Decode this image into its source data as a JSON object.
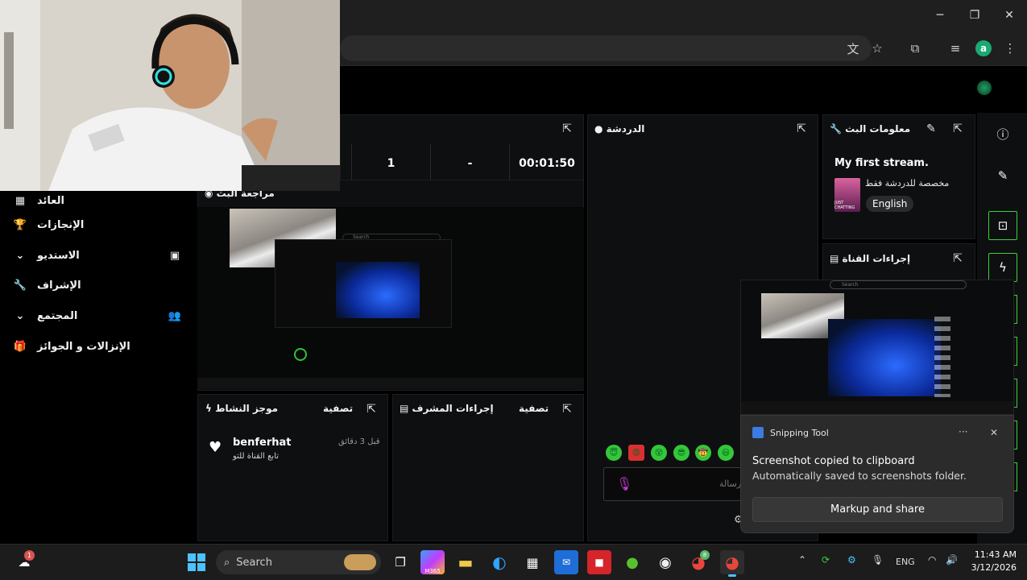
{
  "window": {
    "minimize": "─",
    "maximize": "❐",
    "close": "✕"
  },
  "toolbar_icons": {
    "translate": "文",
    "star": "☆",
    "extensions": "⧉",
    "media": "≡",
    "profile_initial": "a",
    "menu": "⋮"
  },
  "sidebar": {
    "items": [
      {
        "label": "العائد",
        "icon": "dashboard-icon",
        "glyph": "▦"
      },
      {
        "label": "الإنجازات",
        "icon": "trophy-icon",
        "glyph": "🏆"
      },
      {
        "label": "الاستديو",
        "icon": "studio-icon",
        "glyph": "▣",
        "chevron": "⌄"
      },
      {
        "label": "الإشراف",
        "icon": "wrench-icon",
        "glyph": "🔧"
      },
      {
        "label": "المجتمع",
        "icon": "community-icon",
        "glyph": "👥",
        "chevron": "⌄"
      },
      {
        "label": "الإنزالات و الجوائز",
        "icon": "drops-icon",
        "glyph": "🎁"
      }
    ]
  },
  "stats": {
    "viewers": "1",
    "followers": "-",
    "duration": "00:01:50"
  },
  "panels": {
    "stream_preview": "مراجعة البث",
    "chat": "الدردشة",
    "stream_info": "معلومات البث",
    "channel_actions": "إجراءات القناة",
    "activity_feed": "موجز النشاط",
    "activity_filter": "تصفية",
    "mod_actions": "إجراءات المشرف",
    "mod_filter": "تصفية"
  },
  "stream_info": {
    "title": "My first stream.",
    "category": "مخصصة للدردشة فقط",
    "language": "English",
    "thumb_label": "JUST CHATTING"
  },
  "activity": {
    "user": "benferhat",
    "action": "تابع القناة للتو",
    "time": "قبل 3 دقائق"
  },
  "chat": {
    "placeholder": "رسالة",
    "emojis": [
      "😇",
      "😡",
      "😵",
      "😎",
      "🤠",
      "😃"
    ]
  },
  "preview_search": "Search",
  "snip_search": "Search",
  "toast": {
    "app": "Snipping Tool",
    "more": "···",
    "close": "✕",
    "title": "Screenshot copied to clipboard",
    "body": "Automatically saved to screenshots folder.",
    "button": "Markup and share"
  },
  "taskbar": {
    "search_placeholder": "Search",
    "weather_badge": "1",
    "chrome_badge": "8",
    "lang": "ENG",
    "time": "11:43 AM",
    "date": "3/12/2026",
    "m365_label": "M365"
  },
  "colors": {
    "accent": "#3ad13a",
    "panel": "#0e0f10",
    "toast": "#2b2b2b"
  }
}
